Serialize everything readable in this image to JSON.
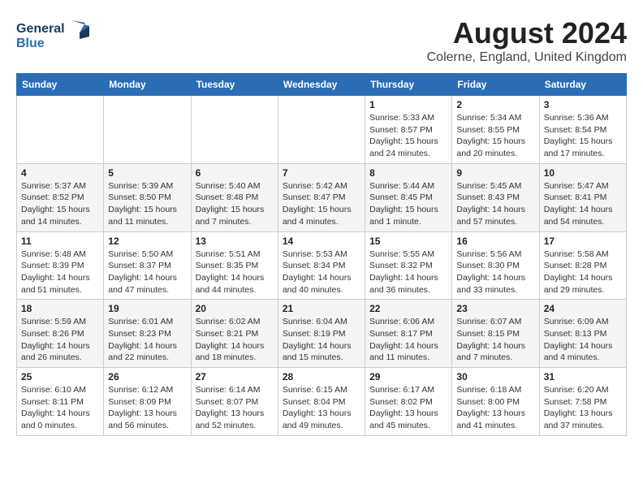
{
  "header": {
    "logo_line1": "General",
    "logo_line2": "Blue",
    "month_year": "August 2024",
    "location": "Colerne, England, United Kingdom"
  },
  "weekdays": [
    "Sunday",
    "Monday",
    "Tuesday",
    "Wednesday",
    "Thursday",
    "Friday",
    "Saturday"
  ],
  "weeks": [
    [
      {
        "day": "",
        "info": ""
      },
      {
        "day": "",
        "info": ""
      },
      {
        "day": "",
        "info": ""
      },
      {
        "day": "",
        "info": ""
      },
      {
        "day": "1",
        "info": "Sunrise: 5:33 AM\nSunset: 8:57 PM\nDaylight: 15 hours\nand 24 minutes."
      },
      {
        "day": "2",
        "info": "Sunrise: 5:34 AM\nSunset: 8:55 PM\nDaylight: 15 hours\nand 20 minutes."
      },
      {
        "day": "3",
        "info": "Sunrise: 5:36 AM\nSunset: 8:54 PM\nDaylight: 15 hours\nand 17 minutes."
      }
    ],
    [
      {
        "day": "4",
        "info": "Sunrise: 5:37 AM\nSunset: 8:52 PM\nDaylight: 15 hours\nand 14 minutes."
      },
      {
        "day": "5",
        "info": "Sunrise: 5:39 AM\nSunset: 8:50 PM\nDaylight: 15 hours\nand 11 minutes."
      },
      {
        "day": "6",
        "info": "Sunrise: 5:40 AM\nSunset: 8:48 PM\nDaylight: 15 hours\nand 7 minutes."
      },
      {
        "day": "7",
        "info": "Sunrise: 5:42 AM\nSunset: 8:47 PM\nDaylight: 15 hours\nand 4 minutes."
      },
      {
        "day": "8",
        "info": "Sunrise: 5:44 AM\nSunset: 8:45 PM\nDaylight: 15 hours\nand 1 minute."
      },
      {
        "day": "9",
        "info": "Sunrise: 5:45 AM\nSunset: 8:43 PM\nDaylight: 14 hours\nand 57 minutes."
      },
      {
        "day": "10",
        "info": "Sunrise: 5:47 AM\nSunset: 8:41 PM\nDaylight: 14 hours\nand 54 minutes."
      }
    ],
    [
      {
        "day": "11",
        "info": "Sunrise: 5:48 AM\nSunset: 8:39 PM\nDaylight: 14 hours\nand 51 minutes."
      },
      {
        "day": "12",
        "info": "Sunrise: 5:50 AM\nSunset: 8:37 PM\nDaylight: 14 hours\nand 47 minutes."
      },
      {
        "day": "13",
        "info": "Sunrise: 5:51 AM\nSunset: 8:35 PM\nDaylight: 14 hours\nand 44 minutes."
      },
      {
        "day": "14",
        "info": "Sunrise: 5:53 AM\nSunset: 8:34 PM\nDaylight: 14 hours\nand 40 minutes."
      },
      {
        "day": "15",
        "info": "Sunrise: 5:55 AM\nSunset: 8:32 PM\nDaylight: 14 hours\nand 36 minutes."
      },
      {
        "day": "16",
        "info": "Sunrise: 5:56 AM\nSunset: 8:30 PM\nDaylight: 14 hours\nand 33 minutes."
      },
      {
        "day": "17",
        "info": "Sunrise: 5:58 AM\nSunset: 8:28 PM\nDaylight: 14 hours\nand 29 minutes."
      }
    ],
    [
      {
        "day": "18",
        "info": "Sunrise: 5:59 AM\nSunset: 8:26 PM\nDaylight: 14 hours\nand 26 minutes."
      },
      {
        "day": "19",
        "info": "Sunrise: 6:01 AM\nSunset: 8:23 PM\nDaylight: 14 hours\nand 22 minutes."
      },
      {
        "day": "20",
        "info": "Sunrise: 6:02 AM\nSunset: 8:21 PM\nDaylight: 14 hours\nand 18 minutes."
      },
      {
        "day": "21",
        "info": "Sunrise: 6:04 AM\nSunset: 8:19 PM\nDaylight: 14 hours\nand 15 minutes."
      },
      {
        "day": "22",
        "info": "Sunrise: 6:06 AM\nSunset: 8:17 PM\nDaylight: 14 hours\nand 11 minutes."
      },
      {
        "day": "23",
        "info": "Sunrise: 6:07 AM\nSunset: 8:15 PM\nDaylight: 14 hours\nand 7 minutes."
      },
      {
        "day": "24",
        "info": "Sunrise: 6:09 AM\nSunset: 8:13 PM\nDaylight: 14 hours\nand 4 minutes."
      }
    ],
    [
      {
        "day": "25",
        "info": "Sunrise: 6:10 AM\nSunset: 8:11 PM\nDaylight: 14 hours\nand 0 minutes."
      },
      {
        "day": "26",
        "info": "Sunrise: 6:12 AM\nSunset: 8:09 PM\nDaylight: 13 hours\nand 56 minutes."
      },
      {
        "day": "27",
        "info": "Sunrise: 6:14 AM\nSunset: 8:07 PM\nDaylight: 13 hours\nand 52 minutes."
      },
      {
        "day": "28",
        "info": "Sunrise: 6:15 AM\nSunset: 8:04 PM\nDaylight: 13 hours\nand 49 minutes."
      },
      {
        "day": "29",
        "info": "Sunrise: 6:17 AM\nSunset: 8:02 PM\nDaylight: 13 hours\nand 45 minutes."
      },
      {
        "day": "30",
        "info": "Sunrise: 6:18 AM\nSunset: 8:00 PM\nDaylight: 13 hours\nand 41 minutes."
      },
      {
        "day": "31",
        "info": "Sunrise: 6:20 AM\nSunset: 7:58 PM\nDaylight: 13 hours\nand 37 minutes."
      }
    ]
  ]
}
